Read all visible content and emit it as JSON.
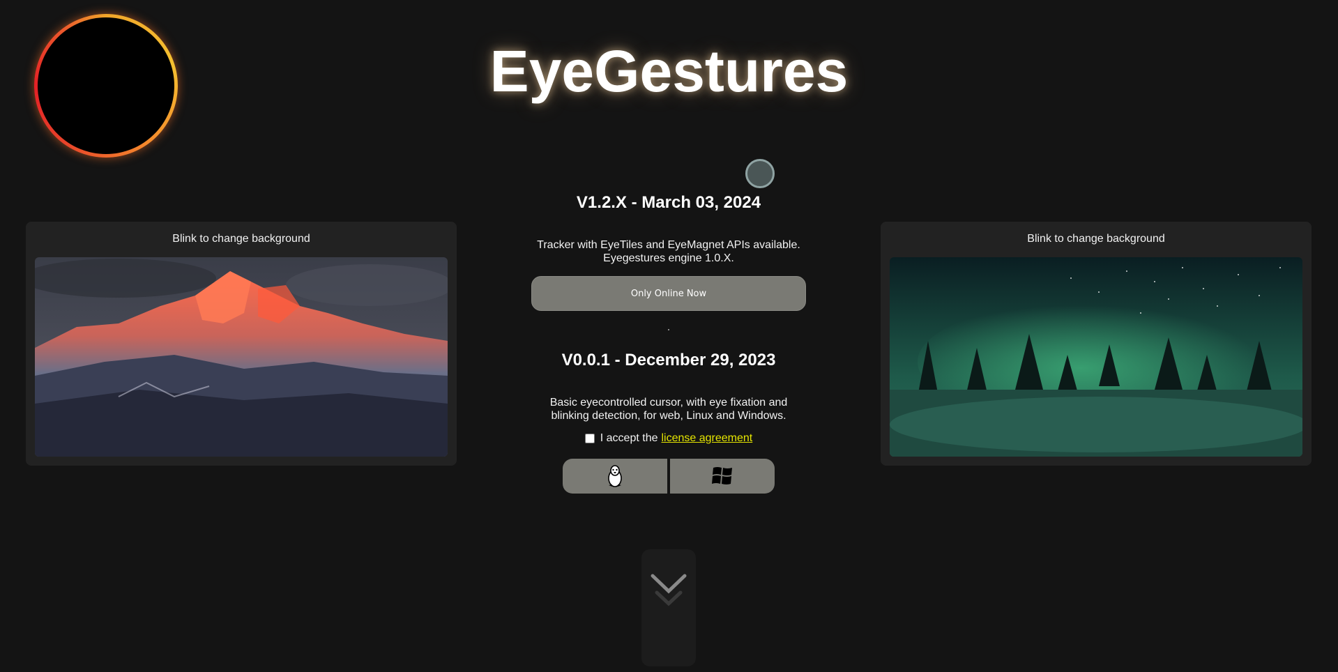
{
  "header": {
    "title": "EyeGestures"
  },
  "left_panel": {
    "caption": "Blink to change background"
  },
  "right_panel": {
    "caption": "Blink to change background"
  },
  "release_latest": {
    "title": "V1.2.X - March 03, 2024",
    "description_line1": "Tracker with EyeTiles and EyeMagnet APIs available.",
    "description_line2": "Eyegestures engine 1.0.X.",
    "button_label": "Only Online Now"
  },
  "release_old": {
    "title": "V0.0.1 - December 29, 2023",
    "description_line1": "Basic eyecontrolled cursor, with eye fixation and",
    "description_line2": "blinking detection, for web, Linux and Windows.",
    "license_prefix": "I accept the",
    "license_link": "license agreement",
    "download_linux_icon": "linux-penguin-icon",
    "download_windows_icon": "windows-logo-icon"
  },
  "colors": {
    "background": "#141414",
    "panel": "#222222",
    "button": "#7a7a74",
    "link": "#e6e600",
    "eclipse_ring": "#f58a2c"
  }
}
